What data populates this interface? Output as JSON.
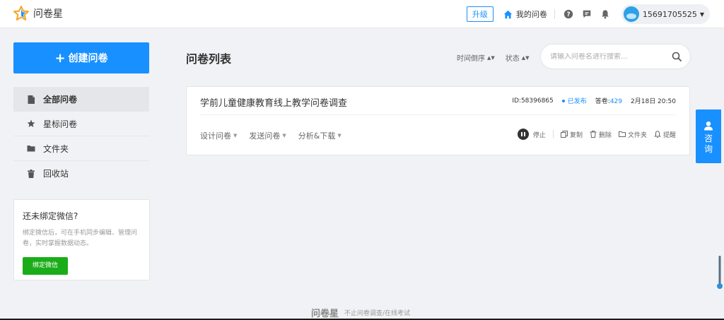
{
  "header": {
    "logo_text": "问卷星",
    "upgrade_label": "升级",
    "my_surveys_label": "我的问卷",
    "user_name": "15691705525",
    "icons": [
      "help-icon",
      "message-icon",
      "bell-icon"
    ]
  },
  "sidebar": {
    "create_label": "创建问卷",
    "items": [
      {
        "label": "全部问卷",
        "icon": "document-icon",
        "active": true
      },
      {
        "label": "星标问卷",
        "icon": "star-icon",
        "active": false
      },
      {
        "label": "文件夹",
        "icon": "folder-icon",
        "active": false
      },
      {
        "label": "回收站",
        "icon": "trash-icon",
        "active": false
      }
    ],
    "wechat": {
      "title": "还未绑定微信?",
      "description": "绑定微信后，可在手机同步编辑、管理问卷，实时掌握数据动态。",
      "button_label": "绑定微信"
    }
  },
  "main": {
    "title": "问卷列表",
    "sort_time_label": "时间倒序",
    "sort_status_label": "状态",
    "search_placeholder": "请输入问卷名进行搜索...",
    "surveys": [
      {
        "title": "学前儿童健康教育线上教学问卷调查",
        "id_text": "ID:58396865",
        "status": "已发布",
        "answers_label": "答卷:",
        "answers_count": "429",
        "date": "2月18日 20:50",
        "actions": [
          "设计问卷",
          "发送问卷",
          "分析&下载"
        ],
        "tools": {
          "stop": "停止",
          "copy": "复制",
          "delete": "删除",
          "folder": "文件夹",
          "remind": "提醒"
        }
      }
    ]
  },
  "consult": {
    "label": "咨询"
  },
  "footer": {
    "logo": "问卷星",
    "slogan": "不止问卷调查/在线考试"
  },
  "colors": {
    "primary": "#1890ff",
    "wechat_green": "#1aad19",
    "page_bg": "#f1f2f5"
  }
}
